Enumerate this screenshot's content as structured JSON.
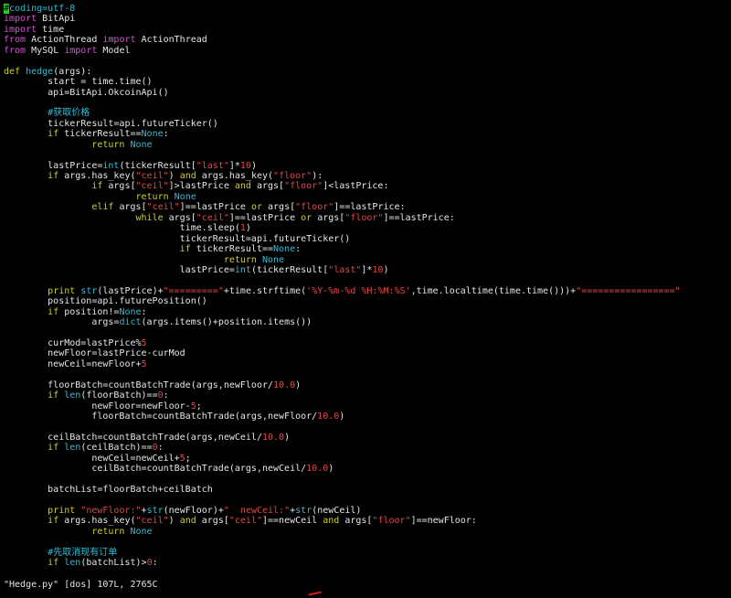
{
  "editor": {
    "file": "Hedge.py",
    "lines": [
      [
        {
          "t": "#",
          "c": "cursor"
        },
        {
          "t": "coding=utf-8",
          "c": "cmt"
        }
      ],
      [
        {
          "t": "import",
          "c": "kw"
        },
        {
          "t": " BitApi"
        }
      ],
      [
        {
          "t": "import",
          "c": "kw"
        },
        {
          "t": " time"
        }
      ],
      [
        {
          "t": "from",
          "c": "kw"
        },
        {
          "t": " ActionThread "
        },
        {
          "t": "import",
          "c": "kw"
        },
        {
          "t": " ActionThread"
        }
      ],
      [
        {
          "t": "from",
          "c": "kw"
        },
        {
          "t": " MySQL "
        },
        {
          "t": "import",
          "c": "kw"
        },
        {
          "t": " Model"
        }
      ],
      [],
      [
        {
          "t": "def",
          "c": "stmt"
        },
        {
          "t": " "
        },
        {
          "t": "hedge",
          "c": "fn"
        },
        {
          "t": "(args):"
        }
      ],
      [
        {
          "t": "        start = time.time()"
        }
      ],
      [
        {
          "t": "        api=BitApi.OkcoinApi()"
        }
      ],
      [],
      [
        {
          "t": "        "
        },
        {
          "t": "#获取价格",
          "c": "cmt"
        }
      ],
      [
        {
          "t": "        tickerResult=api.futureTicker()"
        }
      ],
      [
        {
          "t": "        "
        },
        {
          "t": "if",
          "c": "stmt"
        },
        {
          "t": " tickerResult=="
        },
        {
          "t": "None",
          "c": "con"
        },
        {
          "t": ":"
        }
      ],
      [
        {
          "t": "                "
        },
        {
          "t": "return",
          "c": "stmt"
        },
        {
          "t": " "
        },
        {
          "t": "None",
          "c": "con"
        }
      ],
      [],
      [
        {
          "t": "        lastPrice="
        },
        {
          "t": "int",
          "c": "fn"
        },
        {
          "t": "(tickerResult["
        },
        {
          "t": "\"last\"",
          "c": "str"
        },
        {
          "t": "]*"
        },
        {
          "t": "10",
          "c": "num"
        },
        {
          "t": ")"
        }
      ],
      [
        {
          "t": "        "
        },
        {
          "t": "if",
          "c": "stmt"
        },
        {
          "t": " args.has_key("
        },
        {
          "t": "\"ceil\"",
          "c": "str"
        },
        {
          "t": ") "
        },
        {
          "t": "and",
          "c": "stmt"
        },
        {
          "t": " args.has_key("
        },
        {
          "t": "\"floor\"",
          "c": "str"
        },
        {
          "t": "):"
        }
      ],
      [
        {
          "t": "                "
        },
        {
          "t": "if",
          "c": "stmt"
        },
        {
          "t": " args["
        },
        {
          "t": "\"ceil\"",
          "c": "str"
        },
        {
          "t": "]>lastPrice "
        },
        {
          "t": "and",
          "c": "stmt"
        },
        {
          "t": " args["
        },
        {
          "t": "\"floor\"",
          "c": "str"
        },
        {
          "t": "]<lastPrice:"
        }
      ],
      [
        {
          "t": "                        "
        },
        {
          "t": "return",
          "c": "stmt"
        },
        {
          "t": " "
        },
        {
          "t": "None",
          "c": "con"
        }
      ],
      [
        {
          "t": "                "
        },
        {
          "t": "elif",
          "c": "stmt"
        },
        {
          "t": " args["
        },
        {
          "t": "\"ceil\"",
          "c": "str"
        },
        {
          "t": "]==lastPrice "
        },
        {
          "t": "or",
          "c": "stmt"
        },
        {
          "t": " args["
        },
        {
          "t": "\"floor\"",
          "c": "str"
        },
        {
          "t": "]==lastPrice:"
        }
      ],
      [
        {
          "t": "                        "
        },
        {
          "t": "while",
          "c": "stmt"
        },
        {
          "t": " args["
        },
        {
          "t": "\"ceil\"",
          "c": "str"
        },
        {
          "t": "]==lastPrice "
        },
        {
          "t": "or",
          "c": "stmt"
        },
        {
          "t": " args["
        },
        {
          "t": "\"floor\"",
          "c": "str"
        },
        {
          "t": "]==lastPrice:"
        }
      ],
      [
        {
          "t": "                                time.sleep("
        },
        {
          "t": "1",
          "c": "num"
        },
        {
          "t": ")"
        }
      ],
      [
        {
          "t": "                                tickerResult=api.futureTicker()"
        }
      ],
      [
        {
          "t": "                                "
        },
        {
          "t": "if",
          "c": "stmt"
        },
        {
          "t": " tickerResult=="
        },
        {
          "t": "None",
          "c": "con"
        },
        {
          "t": ":"
        }
      ],
      [
        {
          "t": "                                        "
        },
        {
          "t": "return",
          "c": "stmt"
        },
        {
          "t": " "
        },
        {
          "t": "None",
          "c": "con"
        }
      ],
      [
        {
          "t": "                                lastPrice="
        },
        {
          "t": "int",
          "c": "fn"
        },
        {
          "t": "(tickerResult["
        },
        {
          "t": "\"last\"",
          "c": "str"
        },
        {
          "t": "]*"
        },
        {
          "t": "10",
          "c": "num"
        },
        {
          "t": ")"
        }
      ],
      [],
      [
        {
          "t": "        "
        },
        {
          "t": "print",
          "c": "stmt"
        },
        {
          "t": " "
        },
        {
          "t": "str",
          "c": "fn"
        },
        {
          "t": "(lastPrice)+"
        },
        {
          "t": "\"=========\"",
          "c": "str"
        },
        {
          "t": "+time.strftime("
        },
        {
          "t": "'%Y-%m-%d %H:%M:%S'",
          "c": "str"
        },
        {
          "t": ",time.localtime(time.time()))+"
        },
        {
          "t": "\"=================\"",
          "c": "str"
        }
      ],
      [
        {
          "t": "        position=api.futurePosition()"
        }
      ],
      [
        {
          "t": "        "
        },
        {
          "t": "if",
          "c": "stmt"
        },
        {
          "t": " position!="
        },
        {
          "t": "None",
          "c": "con"
        },
        {
          "t": ":"
        }
      ],
      [
        {
          "t": "                args="
        },
        {
          "t": "dict",
          "c": "fn"
        },
        {
          "t": "(args.items()+position.items())"
        }
      ],
      [],
      [
        {
          "t": "        curMod=lastPrice%"
        },
        {
          "t": "5",
          "c": "num"
        }
      ],
      [
        {
          "t": "        newFloor=lastPrice-curMod"
        }
      ],
      [
        {
          "t": "        newCeil=newFloor+"
        },
        {
          "t": "5",
          "c": "num"
        }
      ],
      [],
      [
        {
          "t": "        floorBatch=countBatchTrade(args,newFloor/"
        },
        {
          "t": "10.0",
          "c": "num"
        },
        {
          "t": ")"
        }
      ],
      [
        {
          "t": "        "
        },
        {
          "t": "if",
          "c": "stmt"
        },
        {
          "t": " "
        },
        {
          "t": "len",
          "c": "fn"
        },
        {
          "t": "(floorBatch)=="
        },
        {
          "t": "0",
          "c": "num"
        },
        {
          "t": ":"
        }
      ],
      [
        {
          "t": "                newFloor=newFloor-"
        },
        {
          "t": "5",
          "c": "num"
        },
        {
          "t": ";"
        }
      ],
      [
        {
          "t": "                floorBatch=countBatchTrade(args,newFloor/"
        },
        {
          "t": "10.0",
          "c": "num"
        },
        {
          "t": ")"
        }
      ],
      [],
      [
        {
          "t": "        ceilBatch=countBatchTrade(args,newCeil/"
        },
        {
          "t": "10.0",
          "c": "num"
        },
        {
          "t": ")"
        }
      ],
      [
        {
          "t": "        "
        },
        {
          "t": "if",
          "c": "stmt"
        },
        {
          "t": " "
        },
        {
          "t": "len",
          "c": "fn"
        },
        {
          "t": "(ceilBatch)=="
        },
        {
          "t": "0",
          "c": "num"
        },
        {
          "t": ":"
        }
      ],
      [
        {
          "t": "                newCeil=newCeil+"
        },
        {
          "t": "5",
          "c": "num"
        },
        {
          "t": ";"
        }
      ],
      [
        {
          "t": "                ceilBatch=countBatchTrade(args,newCeil/"
        },
        {
          "t": "10.0",
          "c": "num"
        },
        {
          "t": ")"
        }
      ],
      [],
      [
        {
          "t": "        batchList=floorBatch+ceilBatch"
        }
      ],
      [],
      [
        {
          "t": "        "
        },
        {
          "t": "print",
          "c": "stmt"
        },
        {
          "t": " "
        },
        {
          "t": "\"newFloor:\"",
          "c": "str"
        },
        {
          "t": "+"
        },
        {
          "t": "str",
          "c": "fn"
        },
        {
          "t": "(newFloor)+"
        },
        {
          "t": "\"  newCeil:\"",
          "c": "str"
        },
        {
          "t": "+"
        },
        {
          "t": "str",
          "c": "fn"
        },
        {
          "t": "(newCeil)"
        }
      ],
      [
        {
          "t": "        "
        },
        {
          "t": "if",
          "c": "stmt"
        },
        {
          "t": " args.has_key("
        },
        {
          "t": "\"ceil\"",
          "c": "str"
        },
        {
          "t": ") "
        },
        {
          "t": "and",
          "c": "stmt"
        },
        {
          "t": " args["
        },
        {
          "t": "\"ceil\"",
          "c": "str"
        },
        {
          "t": "]==newCeil "
        },
        {
          "t": "and",
          "c": "stmt"
        },
        {
          "t": " args["
        },
        {
          "t": "\"floor\"",
          "c": "str"
        },
        {
          "t": "]==newFloor:"
        }
      ],
      [
        {
          "t": "                "
        },
        {
          "t": "return",
          "c": "stmt"
        },
        {
          "t": " "
        },
        {
          "t": "None",
          "c": "con"
        }
      ],
      [],
      [
        {
          "t": "        "
        },
        {
          "t": "#先取消现有订单",
          "c": "cmt"
        }
      ],
      [
        {
          "t": "        "
        },
        {
          "t": "if",
          "c": "stmt"
        },
        {
          "t": " "
        },
        {
          "t": "len",
          "c": "fn"
        },
        {
          "t": "(batchList)>"
        },
        {
          "t": "0",
          "c": "num"
        },
        {
          "t": ":"
        }
      ]
    ]
  },
  "statusbar": {
    "text": "\"Hedge.py\" [dos] 107L, 2765C"
  },
  "colors": {
    "background": "#000000",
    "text": "#e6e6e6",
    "keyword": "#d255d2",
    "statement": "#cfcf26",
    "builtin": "#2dbfd8",
    "string": "#e04848",
    "cursor": "#1fd31f"
  }
}
